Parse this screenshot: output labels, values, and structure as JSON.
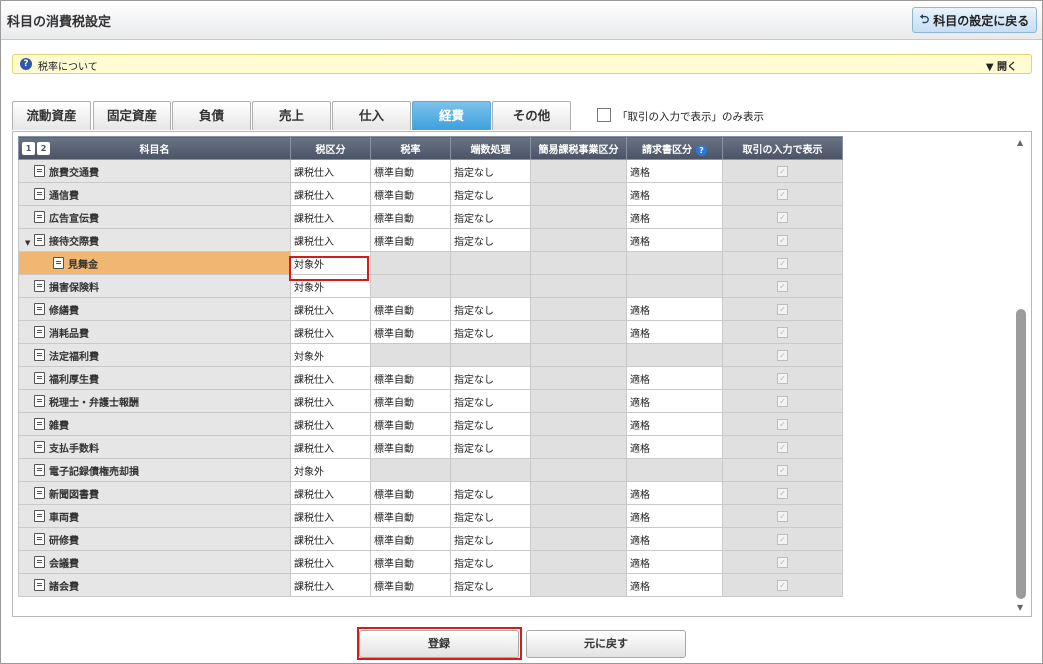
{
  "header": {
    "title": "科目の消費税設定",
    "back_label": "科目の設定に戻る"
  },
  "info": {
    "text": "税率について",
    "toggle": "▼  開く"
  },
  "tabs": [
    "流動資産",
    "固定資産",
    "負債",
    "売上",
    "仕入",
    "経費",
    "その他"
  ],
  "active_tab": "経費",
  "filter": {
    "label": "「取引の入力で表示」のみ表示"
  },
  "grid": {
    "pages": [
      "1",
      "2"
    ],
    "columns": [
      "科目名",
      "税区分",
      "税率",
      "端数処理",
      "簡易課税事業区分",
      "請求書区分",
      "取引の入力で表示"
    ],
    "rows": [
      {
        "name": "旅費交通費",
        "tax": "課税仕入",
        "rate": "標準自動",
        "round": "指定なし",
        "simple": "",
        "invoice": "適格"
      },
      {
        "name": "通信費",
        "tax": "課税仕入",
        "rate": "標準自動",
        "round": "指定なし",
        "simple": "",
        "invoice": "適格"
      },
      {
        "name": "広告宣伝費",
        "tax": "課税仕入",
        "rate": "標準自動",
        "round": "指定なし",
        "simple": "",
        "invoice": "適格"
      },
      {
        "name": "接待交際費",
        "tax": "課税仕入",
        "rate": "標準自動",
        "round": "指定なし",
        "simple": "",
        "invoice": "適格",
        "expanded": true
      },
      {
        "name": "見舞金",
        "tax": "対象外",
        "rate": "",
        "round": "",
        "simple": "",
        "invoice": "",
        "child": true,
        "highlight": true
      },
      {
        "name": "損害保険料",
        "tax": "対象外",
        "rate": "",
        "round": "",
        "simple": "",
        "invoice": ""
      },
      {
        "name": "修繕費",
        "tax": "課税仕入",
        "rate": "標準自動",
        "round": "指定なし",
        "simple": "",
        "invoice": "適格"
      },
      {
        "name": "消耗品費",
        "tax": "課税仕入",
        "rate": "標準自動",
        "round": "指定なし",
        "simple": "",
        "invoice": "適格"
      },
      {
        "name": "法定福利費",
        "tax": "対象外",
        "rate": "",
        "round": "",
        "simple": "",
        "invoice": ""
      },
      {
        "name": "福利厚生費",
        "tax": "課税仕入",
        "rate": "標準自動",
        "round": "指定なし",
        "simple": "",
        "invoice": "適格"
      },
      {
        "name": "税理士・弁護士報酬",
        "tax": "課税仕入",
        "rate": "標準自動",
        "round": "指定なし",
        "simple": "",
        "invoice": "適格"
      },
      {
        "name": "雑費",
        "tax": "課税仕入",
        "rate": "標準自動",
        "round": "指定なし",
        "simple": "",
        "invoice": "適格"
      },
      {
        "name": "支払手数料",
        "tax": "課税仕入",
        "rate": "標準自動",
        "round": "指定なし",
        "simple": "",
        "invoice": "適格"
      },
      {
        "name": "電子記録債権売却損",
        "tax": "対象外",
        "rate": "",
        "round": "",
        "simple": "",
        "invoice": ""
      },
      {
        "name": "新聞図書費",
        "tax": "課税仕入",
        "rate": "標準自動",
        "round": "指定なし",
        "simple": "",
        "invoice": "適格"
      },
      {
        "name": "車両費",
        "tax": "課税仕入",
        "rate": "標準自動",
        "round": "指定なし",
        "simple": "",
        "invoice": "適格"
      },
      {
        "name": "研修費",
        "tax": "課税仕入",
        "rate": "標準自動",
        "round": "指定なし",
        "simple": "",
        "invoice": "適格"
      },
      {
        "name": "会議費",
        "tax": "課税仕入",
        "rate": "標準自動",
        "round": "指定なし",
        "simple": "",
        "invoice": "適格"
      },
      {
        "name": "諸会費",
        "tax": "課税仕入",
        "rate": "標準自動",
        "round": "指定なし",
        "simple": "",
        "invoice": "適格"
      }
    ]
  },
  "footer": {
    "register_label": "登録",
    "revert_label": "元に戻す"
  },
  "colors": {
    "active_tab": "#3d9fdc",
    "highlight_row": "#f2b673",
    "annotation": "#d61b1b",
    "info_bar": "#fffbd3"
  }
}
